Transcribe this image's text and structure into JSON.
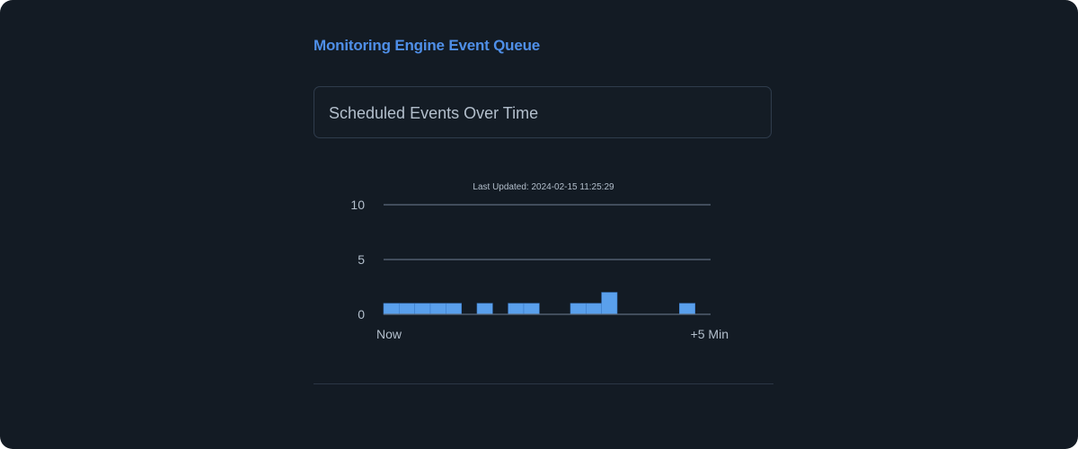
{
  "panel": {
    "title": "Monitoring Engine Event Queue",
    "selected_view": "Scheduled Events Over Time"
  },
  "colors": {
    "background": "#131b24",
    "accent": "#4f8fe8",
    "bar": "#5aa0ec",
    "grid": "#5d6b7d",
    "text": "#b3bfcc"
  },
  "chart_data": {
    "type": "bar",
    "title": "Last Updated: 2024-02-15 11:25:29",
    "ylim": [
      0,
      10
    ],
    "yticks": [
      0,
      5,
      10
    ],
    "x_start_label": "Now",
    "x_end_label": "+5 Min",
    "bucket_count": 21,
    "values": [
      1,
      1,
      1,
      1,
      1,
      0,
      1,
      0,
      1,
      1,
      0,
      0,
      1,
      1,
      2,
      0,
      0,
      0,
      0,
      1,
      0
    ],
    "grid": true,
    "legend": "none"
  }
}
